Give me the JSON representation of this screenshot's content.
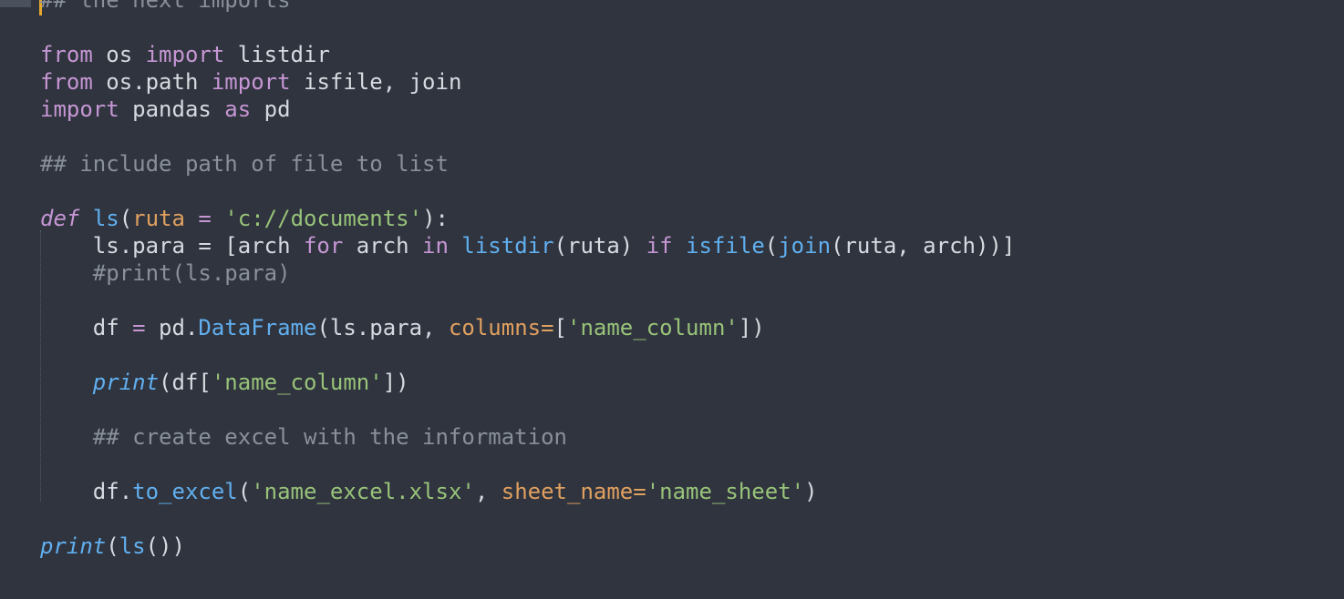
{
  "editor": {
    "lines": [
      [
        {
          "t": "## the next imports",
          "c": "comment"
        }
      ],
      [],
      [
        {
          "t": "from",
          "c": "keyword"
        },
        {
          "t": " os ",
          "c": "plain"
        },
        {
          "t": "import",
          "c": "keyword"
        },
        {
          "t": " listdir",
          "c": "plain"
        }
      ],
      [
        {
          "t": "from",
          "c": "keyword"
        },
        {
          "t": " os.path ",
          "c": "plain"
        },
        {
          "t": "import",
          "c": "keyword"
        },
        {
          "t": " isfile, join",
          "c": "plain"
        }
      ],
      [
        {
          "t": "import",
          "c": "keyword"
        },
        {
          "t": " pandas ",
          "c": "plain"
        },
        {
          "t": "as",
          "c": "keyword"
        },
        {
          "t": " pd",
          "c": "plain"
        }
      ],
      [],
      [
        {
          "t": "## include path of file to list",
          "c": "comment"
        }
      ],
      [],
      [
        {
          "t": "def",
          "c": "def"
        },
        {
          "t": " ",
          "c": "plain"
        },
        {
          "t": "ls",
          "c": "func"
        },
        {
          "t": "(",
          "c": "plain"
        },
        {
          "t": "ruta",
          "c": "param"
        },
        {
          "t": " = ",
          "c": "op"
        },
        {
          "t": "'c://documents'",
          "c": "string"
        },
        {
          "t": "):",
          "c": "plain"
        }
      ],
      [
        {
          "t": "    ls.para = [arch ",
          "c": "plain"
        },
        {
          "t": "for",
          "c": "keyword"
        },
        {
          "t": " arch ",
          "c": "plain"
        },
        {
          "t": "in",
          "c": "keyword"
        },
        {
          "t": " ",
          "c": "plain"
        },
        {
          "t": "listdir",
          "c": "func"
        },
        {
          "t": "(ruta) ",
          "c": "plain"
        },
        {
          "t": "if",
          "c": "keyword"
        },
        {
          "t": " ",
          "c": "plain"
        },
        {
          "t": "isfile",
          "c": "func"
        },
        {
          "t": "(",
          "c": "plain"
        },
        {
          "t": "join",
          "c": "func"
        },
        {
          "t": "(ruta, arch))]",
          "c": "plain"
        }
      ],
      [
        {
          "t": "    #print(ls.para)",
          "c": "comment"
        }
      ],
      [],
      [
        {
          "t": "    df ",
          "c": "plain"
        },
        {
          "t": "=",
          "c": "op"
        },
        {
          "t": " pd.",
          "c": "plain"
        },
        {
          "t": "DataFrame",
          "c": "func"
        },
        {
          "t": "(ls.para, ",
          "c": "plain"
        },
        {
          "t": "columns=",
          "c": "param"
        },
        {
          "t": "[",
          "c": "plain"
        },
        {
          "t": "'name_column'",
          "c": "string"
        },
        {
          "t": "])",
          "c": "plain"
        }
      ],
      [],
      [
        {
          "t": "    ",
          "c": "plain"
        },
        {
          "t": "print",
          "c": "italic"
        },
        {
          "t": "(df[",
          "c": "plain"
        },
        {
          "t": "'name_column'",
          "c": "string"
        },
        {
          "t": "])",
          "c": "plain"
        }
      ],
      [],
      [
        {
          "t": "    ## create excel with the information",
          "c": "comment"
        }
      ],
      [],
      [
        {
          "t": "    df.",
          "c": "plain"
        },
        {
          "t": "to_excel",
          "c": "func"
        },
        {
          "t": "(",
          "c": "plain"
        },
        {
          "t": "'name_excel.xlsx'",
          "c": "string"
        },
        {
          "t": ", ",
          "c": "plain"
        },
        {
          "t": "sheet_name=",
          "c": "param"
        },
        {
          "t": "'name_sheet'",
          "c": "string"
        },
        {
          "t": ")",
          "c": "plain"
        }
      ],
      [],
      [
        {
          "t": "print",
          "c": "italic"
        },
        {
          "t": "(",
          "c": "plain"
        },
        {
          "t": "ls",
          "c": "func"
        },
        {
          "t": "())",
          "c": "plain"
        }
      ]
    ]
  },
  "colors": {
    "background": "#2f343e",
    "keyword": "#c696d4",
    "function": "#61afef",
    "string": "#98c379",
    "parameter": "#e0a060",
    "comment": "#8a909b",
    "cursor": "#e5a72c"
  }
}
